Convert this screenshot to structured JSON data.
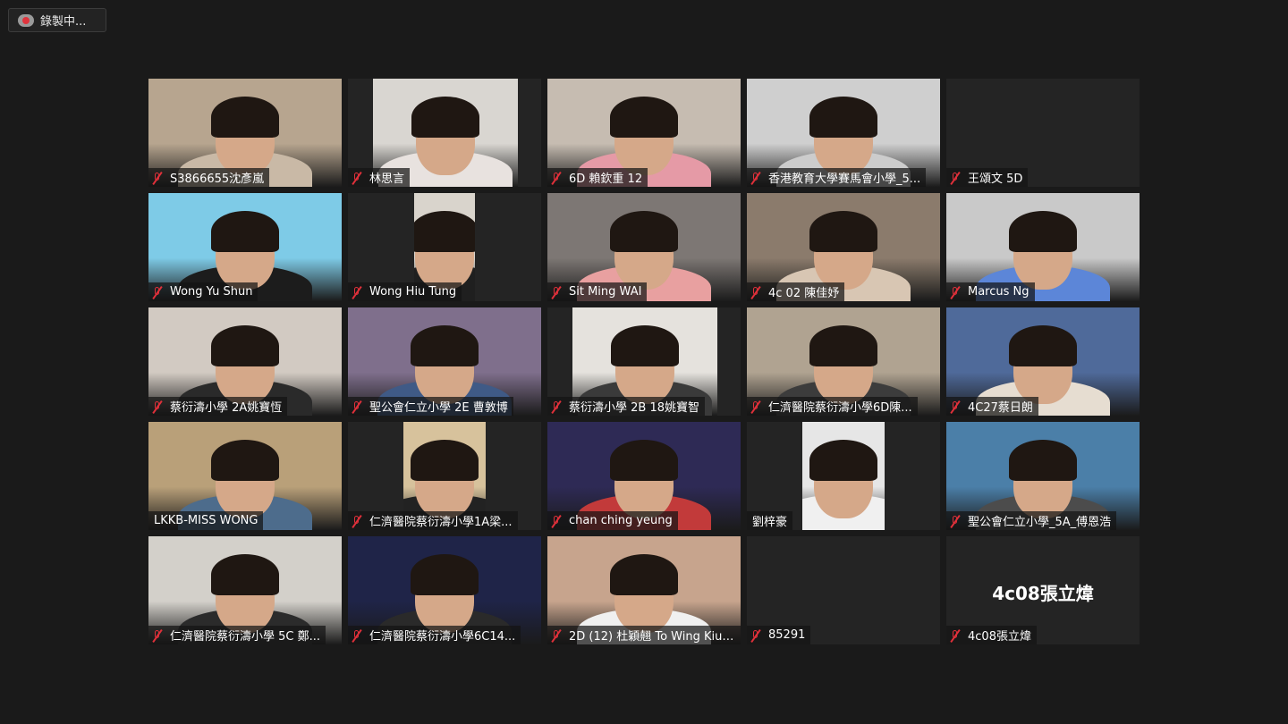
{
  "recording": {
    "label": "錄製中..."
  },
  "participants": [
    {
      "name": "S3866655沈彥嵐",
      "muted": true,
      "bg": "#b7a58f",
      "shirt": "#c9b9a6"
    },
    {
      "name": "林思言",
      "muted": true,
      "bg": "#d9d6d1",
      "shirt": "#e8e2df"
    },
    {
      "name": "6D 賴欽重 12",
      "muted": true,
      "bg": "#c6bcb1",
      "shirt": "#e59aa6"
    },
    {
      "name": "香港教育大學賽馬會小學_5...",
      "muted": true,
      "bg": "#cfcfcf",
      "shirt": "#cccccc"
    },
    {
      "name": "王頌文 5D",
      "muted": true,
      "bg": "#242424",
      "shirt": "#242424",
      "video_off": true
    },
    {
      "name": "Wong Yu Shun",
      "muted": true,
      "bg": "#7ecbe7",
      "shirt": "#1c1c1c"
    },
    {
      "name": "Wong Hiu Tung",
      "muted": true,
      "bg": "#d9d4cc",
      "shirt": "#1f1f1f"
    },
    {
      "name": "Sit Ming WAI",
      "muted": true,
      "bg": "#7d7774",
      "shirt": "#e8a0a0"
    },
    {
      "name": "4c 02 陳佳妤",
      "muted": true,
      "bg": "#8b7b6c",
      "shirt": "#d8c6b3"
    },
    {
      "name": "Marcus Ng",
      "muted": true,
      "bg": "#c9c9c9",
      "shirt": "#5c86d8"
    },
    {
      "name": "蔡衍濤小學 2A姚寶恆",
      "muted": true,
      "bg": "#d2cac2",
      "shirt": "#2a2a2a"
    },
    {
      "name": "聖公會仁立小學 2E 曹敦博",
      "muted": true,
      "bg": "#7f6f8c",
      "shirt": "#3f5a86"
    },
    {
      "name": "蔡衍濤小學 2B 18姚寶智",
      "muted": true,
      "bg": "#e5e2dd",
      "shirt": "#3a3a3a"
    },
    {
      "name": "仁濟醫院蔡衍濤小學6D陳...",
      "muted": true,
      "bg": "#b0a391",
      "shirt": "#3c3c3c"
    },
    {
      "name": "4C27蔡日朗",
      "muted": true,
      "bg": "#4f6a9a",
      "shirt": "#e6ddd1"
    },
    {
      "name": "LKKB-MISS WONG",
      "muted": false,
      "bg": "#b9a079",
      "shirt": "#4d6c8c"
    },
    {
      "name": "仁濟醫院蔡衍濤小學1A梁...",
      "muted": true,
      "bg": "#d7c29c",
      "shirt": "#222222"
    },
    {
      "name": "chan ching yeung",
      "muted": true,
      "bg": "#2e2a55",
      "shirt": "#c23a3a"
    },
    {
      "name": "劉梓豪",
      "muted": false,
      "bg": "#e6e6e6",
      "shirt": "#f0f0f0"
    },
    {
      "name": "聖公會仁立小學_5A_傅恩浩",
      "muted": true,
      "bg": "#4b7fa8",
      "shirt": "#4c4c4c"
    },
    {
      "name": "仁濟醫院蔡衍濤小學 5C 鄭...",
      "muted": true,
      "bg": "#d3d0ca",
      "shirt": "#2b2b2b"
    },
    {
      "name": "仁濟醫院蔡衍濤小學6C14...",
      "muted": true,
      "bg": "#1f2448",
      "shirt": "#2a2a2a"
    },
    {
      "name": "2D (12) 杜穎翹 To Wing Kiu,...",
      "muted": true,
      "bg": "#c7a48d",
      "shirt": "#f0f0f0"
    },
    {
      "name": "85291",
      "muted": true,
      "bg": "#242424",
      "shirt": "#242424",
      "video_off": true
    },
    {
      "name": "4c08張立煒",
      "muted": true,
      "bg": "#242424",
      "shirt": "#242424",
      "video_off": true,
      "center_name": "4c08張立煒"
    }
  ]
}
